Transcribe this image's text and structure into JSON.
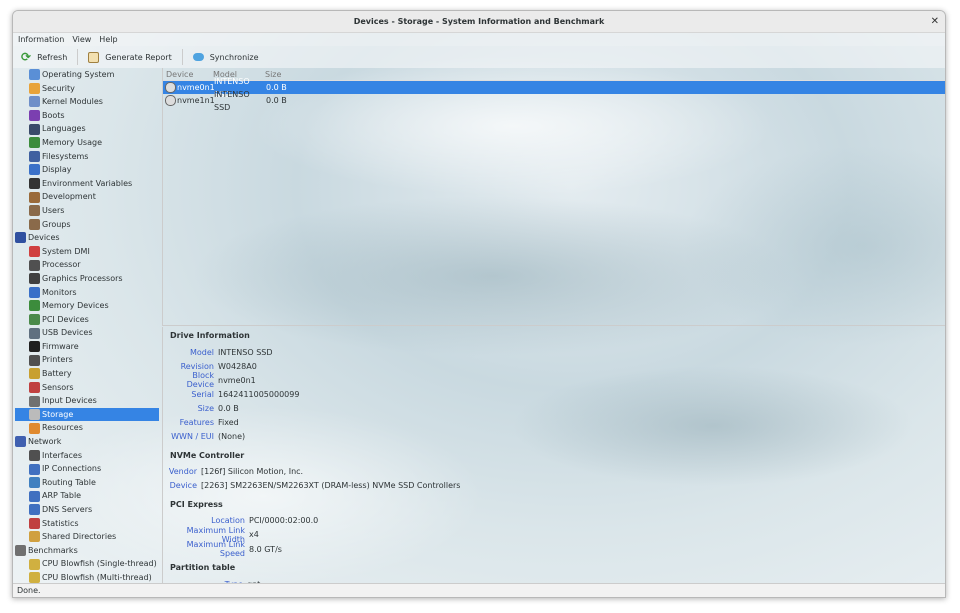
{
  "window": {
    "title": "Devices - Storage - System Information and Benchmark"
  },
  "menu": [
    "Information",
    "View",
    "Help"
  ],
  "toolbar": {
    "refresh": "Refresh",
    "report": "Generate Report",
    "sync": "Synchronize"
  },
  "sidebar": [
    {
      "label": "Operating System",
      "level": 1,
      "color": "#5a8fd6"
    },
    {
      "label": "Security",
      "level": 1,
      "color": "#e8a33a"
    },
    {
      "label": "Kernel Modules",
      "level": 1,
      "color": "#6f8fc8"
    },
    {
      "label": "Boots",
      "level": 1,
      "color": "#7b3fb0"
    },
    {
      "label": "Languages",
      "level": 1,
      "color": "#3a4a6a"
    },
    {
      "label": "Memory Usage",
      "level": 1,
      "color": "#3c8c3c"
    },
    {
      "label": "Filesystems",
      "level": 1,
      "color": "#4060a0"
    },
    {
      "label": "Display",
      "level": 1,
      "color": "#3a70c8"
    },
    {
      "label": "Environment Variables",
      "level": 1,
      "color": "#333333"
    },
    {
      "label": "Development",
      "level": 1,
      "color": "#9a6a3a"
    },
    {
      "label": "Users",
      "level": 1,
      "color": "#8a6a4a"
    },
    {
      "label": "Groups",
      "level": 1,
      "color": "#8a6a4a"
    },
    {
      "label": "Devices",
      "level": 0,
      "color": "#3050a0"
    },
    {
      "label": "System DMI",
      "level": 1,
      "color": "#d04040"
    },
    {
      "label": "Processor",
      "level": 1,
      "color": "#505050"
    },
    {
      "label": "Graphics Processors",
      "level": 1,
      "color": "#404040"
    },
    {
      "label": "Monitors",
      "level": 1,
      "color": "#3a70c8"
    },
    {
      "label": "Memory Devices",
      "level": 1,
      "color": "#3c8c3c"
    },
    {
      "label": "PCI Devices",
      "level": 1,
      "color": "#4a8a4a"
    },
    {
      "label": "USB Devices",
      "level": 1,
      "color": "#607080"
    },
    {
      "label": "Firmware",
      "level": 1,
      "color": "#202020"
    },
    {
      "label": "Printers",
      "level": 1,
      "color": "#505050"
    },
    {
      "label": "Battery",
      "level": 1,
      "color": "#c8a030"
    },
    {
      "label": "Sensors",
      "level": 1,
      "color": "#c04040"
    },
    {
      "label": "Input Devices",
      "level": 1,
      "color": "#707070"
    },
    {
      "label": "Storage",
      "level": 1,
      "color": "#bbbbbb",
      "selected": true
    },
    {
      "label": "Resources",
      "level": 1,
      "color": "#e08a30"
    },
    {
      "label": "Network",
      "level": 0,
      "color": "#4060b0"
    },
    {
      "label": "Interfaces",
      "level": 1,
      "color": "#505050"
    },
    {
      "label": "IP Connections",
      "level": 1,
      "color": "#4070c0"
    },
    {
      "label": "Routing Table",
      "level": 1,
      "color": "#4080c0"
    },
    {
      "label": "ARP Table",
      "level": 1,
      "color": "#4070c0"
    },
    {
      "label": "DNS Servers",
      "level": 1,
      "color": "#4070c0"
    },
    {
      "label": "Statistics",
      "level": 1,
      "color": "#c04040"
    },
    {
      "label": "Shared Directories",
      "level": 1,
      "color": "#d0a040"
    },
    {
      "label": "Benchmarks",
      "level": 0,
      "color": "#707070"
    },
    {
      "label": "CPU Blowfish (Single-thread)",
      "level": 1,
      "color": "#d0b040"
    },
    {
      "label": "CPU Blowfish (Multi-thread)",
      "level": 1,
      "color": "#d0b040"
    }
  ],
  "list": {
    "headers": [
      "Device",
      "Model",
      "Size"
    ],
    "rows": [
      [
        "nvme0n1",
        "INTENSO SSD",
        "0.0 B"
      ],
      [
        "nvme1n1",
        "INTENSO SSD",
        "0.0 B"
      ]
    ]
  },
  "details": [
    {
      "title": "Drive Information",
      "kw": 47,
      "rows": [
        [
          "Model",
          "INTENSO SSD"
        ],
        [
          "Revision",
          "W0428A0"
        ],
        [
          "Block Device",
          "nvme0n1"
        ],
        [
          "Serial",
          "1642411005000099"
        ],
        [
          "Size",
          "0.0 B"
        ],
        [
          "Features",
          "Fixed"
        ],
        [
          "WWN / EUI",
          "(None)"
        ]
      ]
    },
    {
      "title": "NVMe Controller",
      "kw": 30,
      "rows": [
        [
          "Vendor",
          "[126f] Silicon Motion, Inc."
        ],
        [
          "Device",
          "[2263] SM2263EN/SM2263XT (DRAM-less) NVMe SSD Controllers"
        ]
      ]
    },
    {
      "title": "PCI Express",
      "kw": 78,
      "rows": [
        [
          "Location",
          "PCI/0000:02:00.0"
        ],
        [
          "Maximum Link Width",
          "x4"
        ],
        [
          "Maximum Link Speed",
          "8.0 GT/s"
        ]
      ]
    },
    {
      "title": "Partition table",
      "kw": 76,
      "rows": [
        [
          "Type",
          "gpt"
        ]
      ]
    }
  ],
  "status": "Done."
}
